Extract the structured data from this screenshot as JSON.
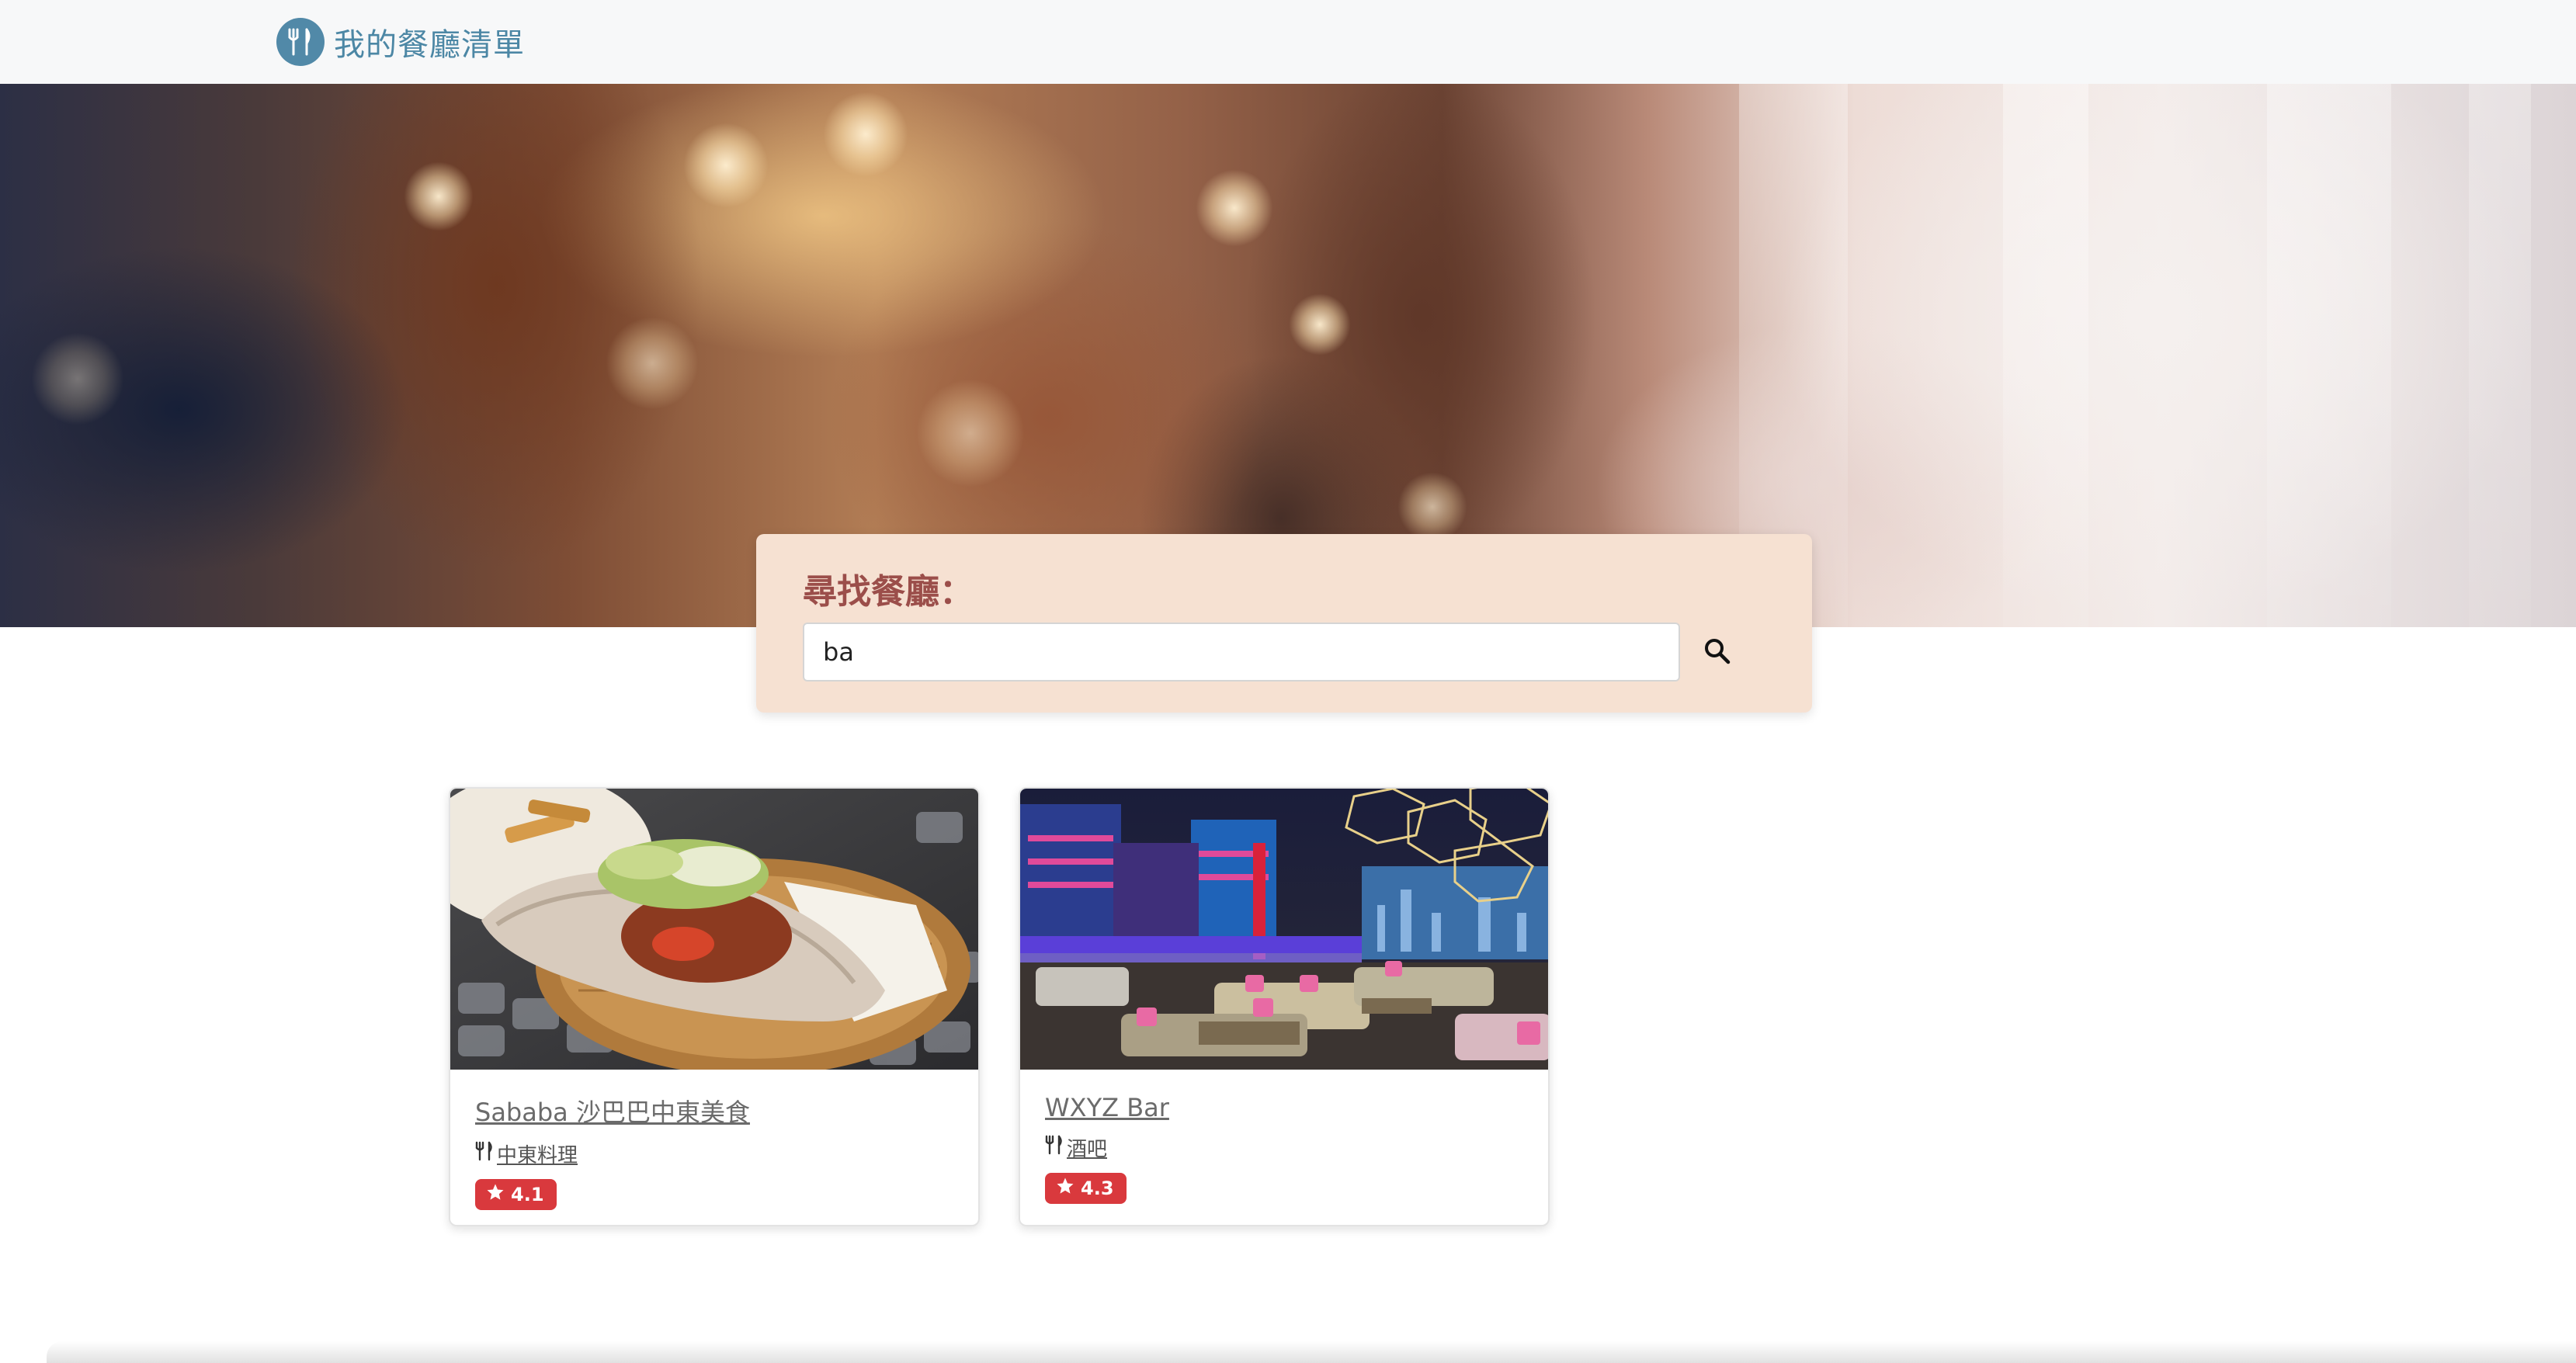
{
  "navbar": {
    "brand_name": "我的餐廳清單",
    "brand_icon": "utensils-icon"
  },
  "search": {
    "title": "尋找餐廳：",
    "value": "ba",
    "button_icon": "search-icon"
  },
  "restaurants": [
    {
      "name": "Sababa 沙巴巴中東美食",
      "category": "中東料理",
      "rating": "4.1",
      "category_icon": "utensils-icon",
      "rating_icon": "star-icon"
    },
    {
      "name": "WXYZ Bar",
      "category": "酒吧",
      "rating": "4.3",
      "category_icon": "utensils-icon",
      "rating_icon": "star-icon"
    }
  ],
  "colors": {
    "brand": "#4c87a5",
    "search_panel_bg": "#f6e1d2",
    "search_title": "#9b4e4a",
    "rating_badge": "#d9393d"
  }
}
